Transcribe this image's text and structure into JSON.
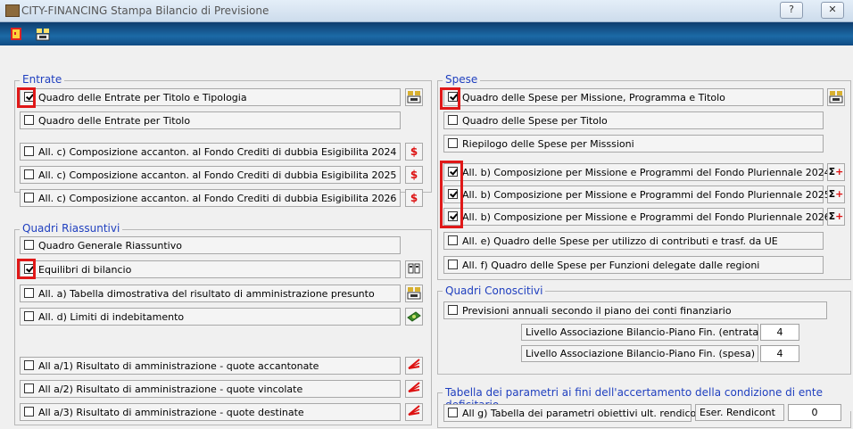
{
  "window": {
    "title": "CITY-FINANCING  Stampa Bilancio di Previsione",
    "help_label": "?",
    "close_label": "✕"
  },
  "entrate": {
    "title": "Entrate",
    "rows": [
      {
        "label": "Quadro delle Entrate per Titolo e Tipologia",
        "checked": true
      },
      {
        "label": "Quadro delle Entrate per Titolo",
        "checked": false
      },
      {
        "label": "All. c) Composizione accanton. al Fondo Crediti di dubbia Esigibilita 2024",
        "checked": false
      },
      {
        "label": "All. c) Composizione accanton. al Fondo Crediti di dubbia Esigibilita 2025",
        "checked": false
      },
      {
        "label": "All. c) Composizione accanton. al Fondo Crediti di dubbia Esigibilita 2026",
        "checked": false
      }
    ]
  },
  "quadri": {
    "title": "Quadri Riassuntivi",
    "rows": [
      {
        "label": "Quadro Generale Riassuntivo",
        "checked": false
      },
      {
        "label": "Equilibri di bilancio",
        "checked": true
      },
      {
        "label": "All. a) Tabella dimostrativa del risultato di amministrazione presunto",
        "checked": false
      },
      {
        "label": "All. d) Limiti di indebitamento",
        "checked": false
      },
      {
        "label": "All a/1)  Risultato di amministrazione - quote accantonate",
        "checked": false
      },
      {
        "label": "All a/2)  Risultato di amministrazione - quote vincolate",
        "checked": false
      },
      {
        "label": "All a/3)  Risultato di amministrazione - quote destinate",
        "checked": false
      }
    ]
  },
  "spese": {
    "title": "Spese",
    "rows": [
      {
        "label": "Quadro delle  Spese per Missione, Programma e Titolo",
        "checked": true
      },
      {
        "label": "Quadro delle Spese per Titolo",
        "checked": false
      },
      {
        "label": "Riepilogo delle Spese per Misssioni",
        "checked": false
      },
      {
        "label": "All. b) Composizione per Missione e Programmi del Fondo Pluriennale 2024",
        "checked": true
      },
      {
        "label": "All. b) Composizione per Missione e Programmi del Fondo Pluriennale 2025",
        "checked": true
      },
      {
        "label": "All. b) Composizione per Missione e Programmi del Fondo Pluriennale 2026",
        "checked": true
      },
      {
        "label": "All. e) Quadro delle  Spese per utilizzo di contributi e trasf. da UE",
        "checked": false
      },
      {
        "label": "All. f) Quadro delle  Spese per Funzioni delegate dalle regioni",
        "checked": false
      }
    ]
  },
  "conoscitivi": {
    "title": "Quadri Conoscitivi",
    "row": {
      "label": "Previsioni annuali secondo il piano dei conti finanziario",
      "checked": false
    },
    "livello_entrata": {
      "label": "Livello Associazione Bilancio-Piano Fin. (entrata",
      "value": "4"
    },
    "livello_spesa": {
      "label": "Livello Associazione Bilancio-Piano Fin. (spesa)",
      "value": "4"
    }
  },
  "parametri": {
    "title": "Tabella dei parametri ai fini dell'accertamento della condizione di ente deficitario",
    "row": {
      "label": "All g) Tabella dei parametri obiettivi ult. rendiconto",
      "checked": false
    },
    "eser_label": "Eser. Rendicont",
    "eser_value": "0"
  },
  "icons": {
    "sigma_plus": "Σ+",
    "dollar": "$"
  }
}
